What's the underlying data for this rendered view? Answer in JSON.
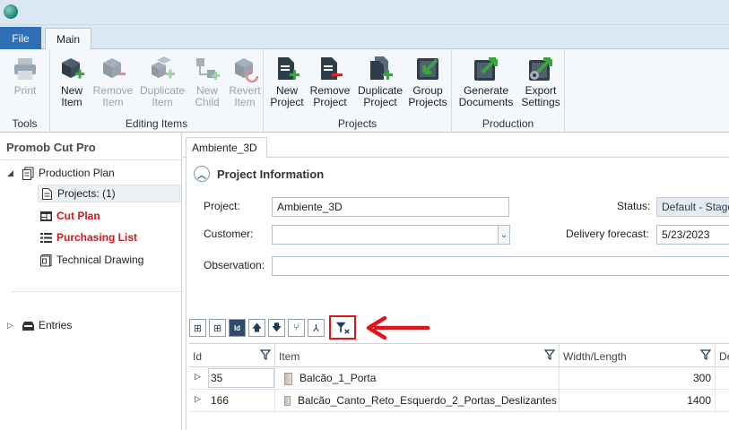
{
  "tabs": {
    "file": "File",
    "main": "Main"
  },
  "ribbon": {
    "groups": {
      "tools": "Tools",
      "editing": "Editing Items",
      "projects": "Projects",
      "production": "Production"
    },
    "buttons": {
      "print": "Print",
      "new_item": "New\nItem",
      "remove_item": "Remove\nItem",
      "duplicate_item": "Duplicate\nItem",
      "new_child": "New\nChild",
      "revert_item": "Revert\nItem",
      "new_project": "New\nProject",
      "remove_project": "Remove\nProject",
      "duplicate_project": "Duplicate\nProject",
      "group_projects": "Group\nProjects",
      "generate_documents": "Generate\nDocuments",
      "export_settings": "Export\nSettings"
    }
  },
  "sidebar": {
    "title": "Promob Cut Pro",
    "items": [
      {
        "label": "Production Plan"
      },
      {
        "label": "Projects: (1)"
      },
      {
        "label": "Cut Plan"
      },
      {
        "label": "Purchasing List"
      },
      {
        "label": "Technical Drawing"
      },
      {
        "label": "Entries"
      }
    ]
  },
  "document": {
    "tab": "Ambiente_3D",
    "section_title": "Project Information",
    "fields": {
      "project_label": "Project:",
      "project_value": "Ambiente_3D",
      "customer_label": "Customer:",
      "customer_value": "",
      "observation_label": "Observation:",
      "observation_value": "",
      "status_label": "Status:",
      "status_value": "Default - Stage",
      "delivery_label": "Delivery forecast:",
      "delivery_value": "5/23/2023"
    }
  },
  "grid": {
    "columns": [
      "Id",
      "Item",
      "Width/Length",
      "De"
    ],
    "rows": [
      {
        "id": "35",
        "item": "Balcão_1_Porta",
        "width": "300"
      },
      {
        "id": "166",
        "item": "Balcão_Canto_Reto_Esquerdo_2_Portas_Deslizantes",
        "width": "1400"
      }
    ]
  },
  "colors": {
    "accent": "#2f6fb6",
    "highlight_red": "#e1141a",
    "green_icon": "#3aa53a",
    "red_icon": "#d8262b"
  }
}
